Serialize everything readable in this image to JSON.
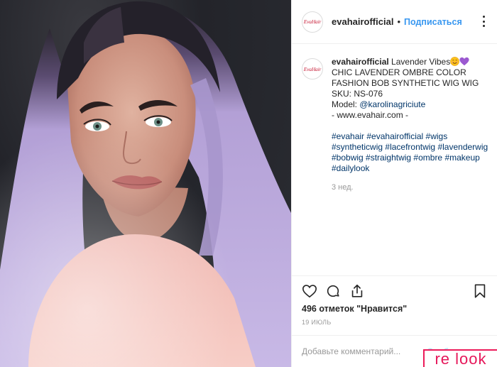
{
  "post": {
    "photo_alt": "",
    "header": {
      "avatar_text": "EvaHair",
      "username": "evahairofficial",
      "separator": "•",
      "follow_label": "Подписаться"
    },
    "caption": {
      "username": "evahairofficial",
      "line1": "Lavender Vibes",
      "line2": "CHIC LAVENDER OMBRE COLOR FASHION BOB SYNTHETIC WIG WIG SKU: NS-076",
      "model_label": "Model: ",
      "model_link": "@karolinagriciute",
      "site_line": "- www.evahair.com -",
      "hashtags": [
        "#evahair",
        "#evahairofficial",
        "#wigs",
        "#syntheticwig",
        "#lacefrontwig",
        "#lavenderwig",
        "#bobwig",
        "#straightwig",
        "#ombre",
        "#makeup",
        "#dailylook"
      ],
      "time": "3 нед."
    },
    "likes_text": "496 отметок \"Нравится\"",
    "date_text": "19 ИЮЛЬ",
    "comment": {
      "placeholder": "Добавьте комментарий...",
      "post_label": "Опубликовать"
    },
    "icons": [
      "heart-icon",
      "comment-icon",
      "share-icon",
      "bookmark-icon",
      "more-options-icon",
      "smile-emoji-icon",
      "purple-heart-emoji-icon"
    ],
    "colors": {
      "link": "#003569",
      "follow": "#3897f0",
      "meta": "#999999",
      "watermark": "#e6175a"
    }
  },
  "watermark": {
    "text": "re look"
  }
}
